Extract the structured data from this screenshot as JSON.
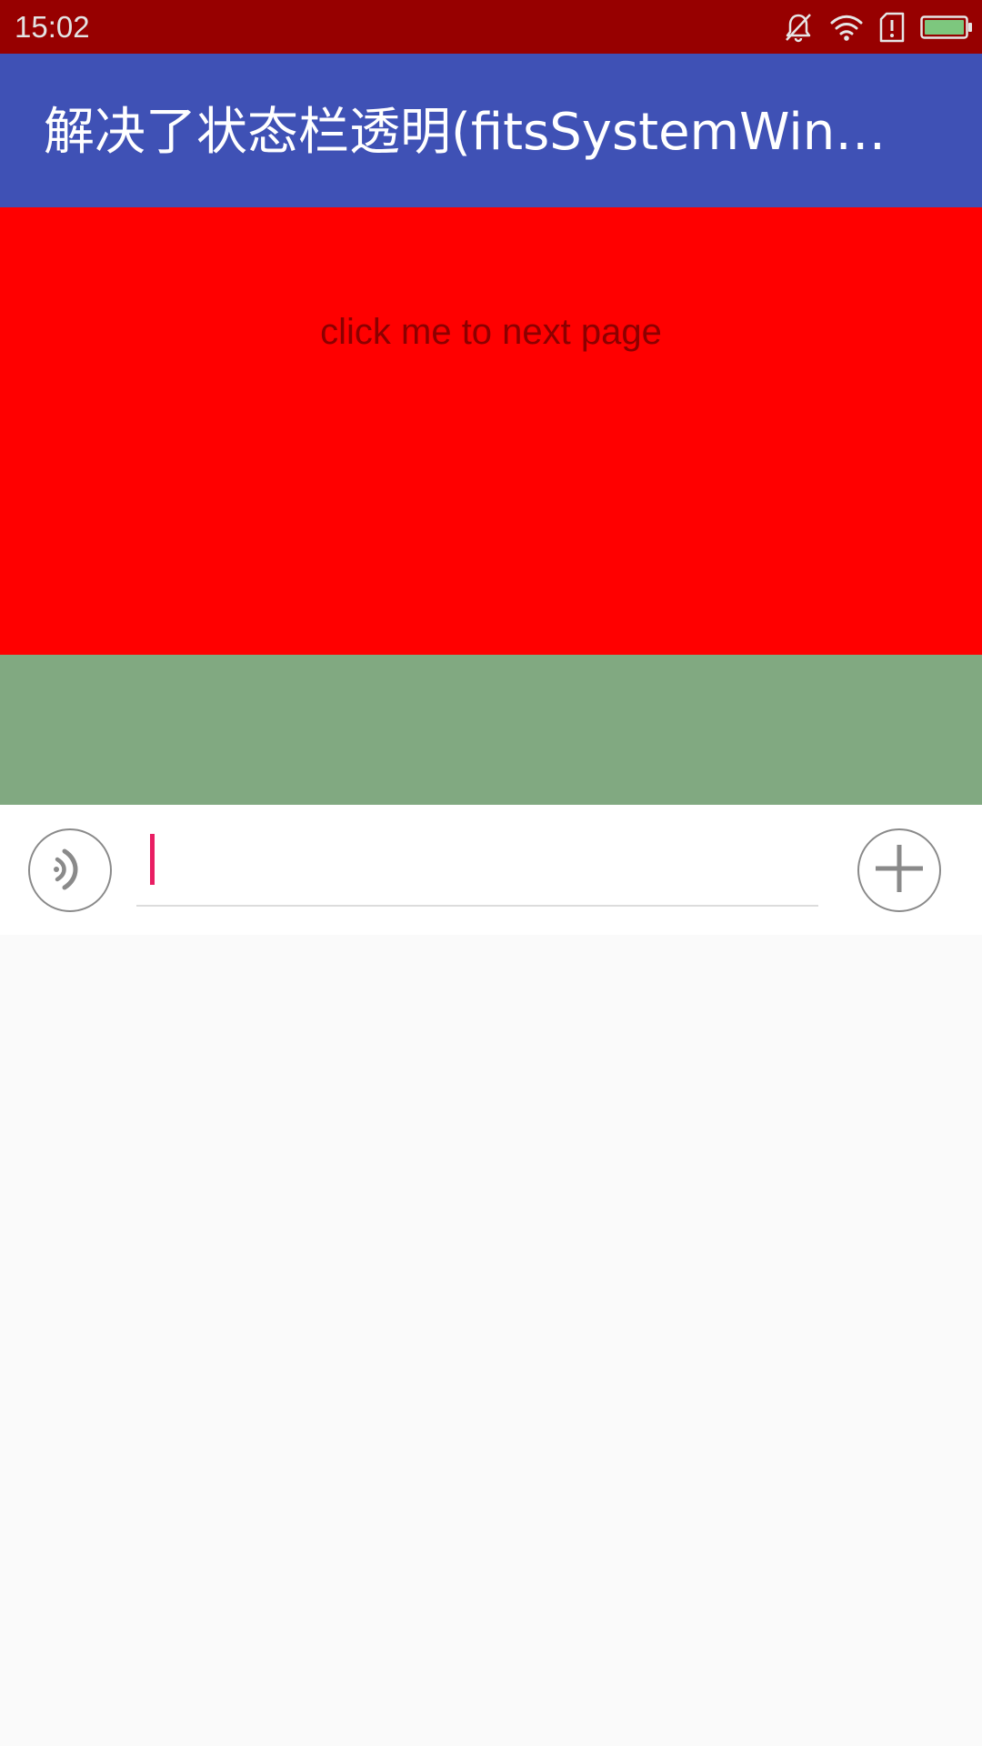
{
  "status_bar": {
    "time": "15:02",
    "icons": [
      "notifications-off-icon",
      "wifi-icon",
      "sim-alert-icon",
      "battery-icon"
    ],
    "background_color": "#970000",
    "battery_color": "#7DC77E"
  },
  "app_bar": {
    "title": "解决了状态栏透明(fitsSystemWindows)",
    "background_color": "#3F51B5"
  },
  "red_area": {
    "link_text": "click me to next page",
    "background_color": "#FF0000"
  },
  "green_area": {
    "background_color": "#81A981"
  },
  "input_bar": {
    "left_icon": "voice-icon",
    "message_value": "",
    "right_icon": "plus-icon",
    "cursor_color": "#E91E63"
  }
}
